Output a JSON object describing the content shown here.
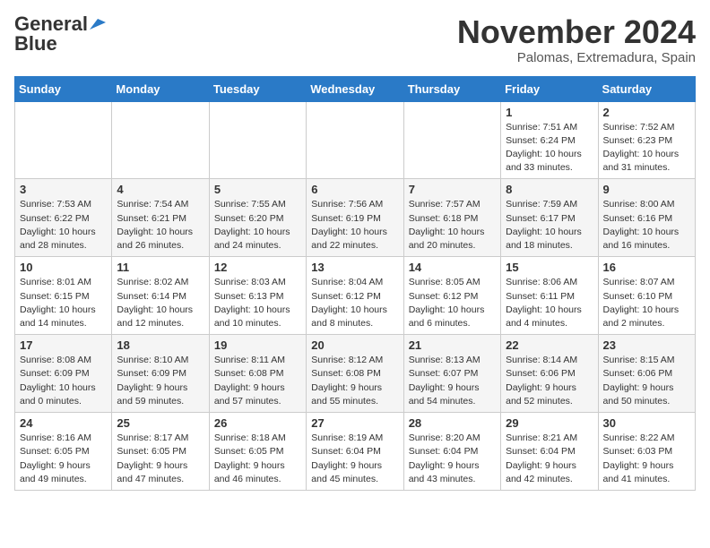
{
  "logo": {
    "general": "General",
    "blue": "Blue"
  },
  "title": "November 2024",
  "location": "Palomas, Extremadura, Spain",
  "days_of_week": [
    "Sunday",
    "Monday",
    "Tuesday",
    "Wednesday",
    "Thursday",
    "Friday",
    "Saturday"
  ],
  "weeks": [
    [
      {
        "day": "",
        "info": ""
      },
      {
        "day": "",
        "info": ""
      },
      {
        "day": "",
        "info": ""
      },
      {
        "day": "",
        "info": ""
      },
      {
        "day": "",
        "info": ""
      },
      {
        "day": "1",
        "info": "Sunrise: 7:51 AM\nSunset: 6:24 PM\nDaylight: 10 hours and 33 minutes."
      },
      {
        "day": "2",
        "info": "Sunrise: 7:52 AM\nSunset: 6:23 PM\nDaylight: 10 hours and 31 minutes."
      }
    ],
    [
      {
        "day": "3",
        "info": "Sunrise: 7:53 AM\nSunset: 6:22 PM\nDaylight: 10 hours and 28 minutes."
      },
      {
        "day": "4",
        "info": "Sunrise: 7:54 AM\nSunset: 6:21 PM\nDaylight: 10 hours and 26 minutes."
      },
      {
        "day": "5",
        "info": "Sunrise: 7:55 AM\nSunset: 6:20 PM\nDaylight: 10 hours and 24 minutes."
      },
      {
        "day": "6",
        "info": "Sunrise: 7:56 AM\nSunset: 6:19 PM\nDaylight: 10 hours and 22 minutes."
      },
      {
        "day": "7",
        "info": "Sunrise: 7:57 AM\nSunset: 6:18 PM\nDaylight: 10 hours and 20 minutes."
      },
      {
        "day": "8",
        "info": "Sunrise: 7:59 AM\nSunset: 6:17 PM\nDaylight: 10 hours and 18 minutes."
      },
      {
        "day": "9",
        "info": "Sunrise: 8:00 AM\nSunset: 6:16 PM\nDaylight: 10 hours and 16 minutes."
      }
    ],
    [
      {
        "day": "10",
        "info": "Sunrise: 8:01 AM\nSunset: 6:15 PM\nDaylight: 10 hours and 14 minutes."
      },
      {
        "day": "11",
        "info": "Sunrise: 8:02 AM\nSunset: 6:14 PM\nDaylight: 10 hours and 12 minutes."
      },
      {
        "day": "12",
        "info": "Sunrise: 8:03 AM\nSunset: 6:13 PM\nDaylight: 10 hours and 10 minutes."
      },
      {
        "day": "13",
        "info": "Sunrise: 8:04 AM\nSunset: 6:12 PM\nDaylight: 10 hours and 8 minutes."
      },
      {
        "day": "14",
        "info": "Sunrise: 8:05 AM\nSunset: 6:12 PM\nDaylight: 10 hours and 6 minutes."
      },
      {
        "day": "15",
        "info": "Sunrise: 8:06 AM\nSunset: 6:11 PM\nDaylight: 10 hours and 4 minutes."
      },
      {
        "day": "16",
        "info": "Sunrise: 8:07 AM\nSunset: 6:10 PM\nDaylight: 10 hours and 2 minutes."
      }
    ],
    [
      {
        "day": "17",
        "info": "Sunrise: 8:08 AM\nSunset: 6:09 PM\nDaylight: 10 hours and 0 minutes."
      },
      {
        "day": "18",
        "info": "Sunrise: 8:10 AM\nSunset: 6:09 PM\nDaylight: 9 hours and 59 minutes."
      },
      {
        "day": "19",
        "info": "Sunrise: 8:11 AM\nSunset: 6:08 PM\nDaylight: 9 hours and 57 minutes."
      },
      {
        "day": "20",
        "info": "Sunrise: 8:12 AM\nSunset: 6:08 PM\nDaylight: 9 hours and 55 minutes."
      },
      {
        "day": "21",
        "info": "Sunrise: 8:13 AM\nSunset: 6:07 PM\nDaylight: 9 hours and 54 minutes."
      },
      {
        "day": "22",
        "info": "Sunrise: 8:14 AM\nSunset: 6:06 PM\nDaylight: 9 hours and 52 minutes."
      },
      {
        "day": "23",
        "info": "Sunrise: 8:15 AM\nSunset: 6:06 PM\nDaylight: 9 hours and 50 minutes."
      }
    ],
    [
      {
        "day": "24",
        "info": "Sunrise: 8:16 AM\nSunset: 6:05 PM\nDaylight: 9 hours and 49 minutes."
      },
      {
        "day": "25",
        "info": "Sunrise: 8:17 AM\nSunset: 6:05 PM\nDaylight: 9 hours and 47 minutes."
      },
      {
        "day": "26",
        "info": "Sunrise: 8:18 AM\nSunset: 6:05 PM\nDaylight: 9 hours and 46 minutes."
      },
      {
        "day": "27",
        "info": "Sunrise: 8:19 AM\nSunset: 6:04 PM\nDaylight: 9 hours and 45 minutes."
      },
      {
        "day": "28",
        "info": "Sunrise: 8:20 AM\nSunset: 6:04 PM\nDaylight: 9 hours and 43 minutes."
      },
      {
        "day": "29",
        "info": "Sunrise: 8:21 AM\nSunset: 6:04 PM\nDaylight: 9 hours and 42 minutes."
      },
      {
        "day": "30",
        "info": "Sunrise: 8:22 AM\nSunset: 6:03 PM\nDaylight: 9 hours and 41 minutes."
      }
    ]
  ]
}
